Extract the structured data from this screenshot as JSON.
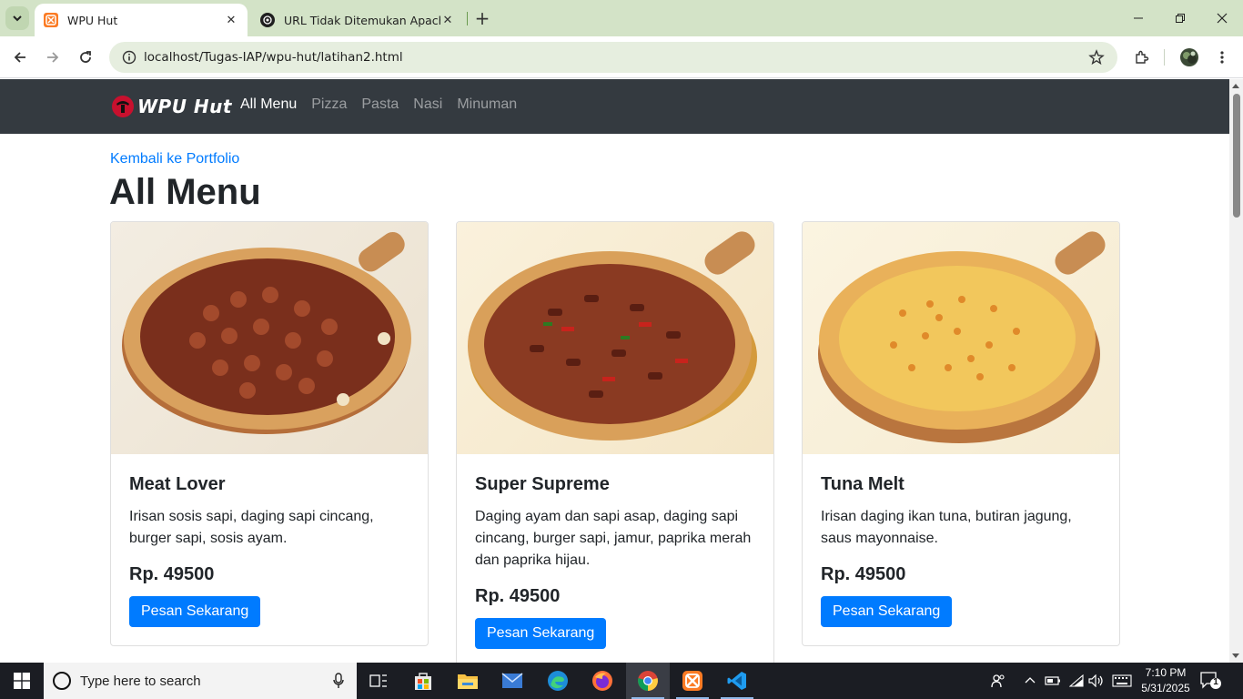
{
  "browser": {
    "tabs": [
      {
        "title": "WPU Hut",
        "active": true
      },
      {
        "title": "URL Tidak Ditemukan Apache",
        "active": false
      }
    ],
    "url": "localhost/Tugas-IAP/wpu-hut/latihan2.html"
  },
  "navbar": {
    "brand": "WPU Hut",
    "items": [
      {
        "label": "All Menu",
        "active": true
      },
      {
        "label": "Pizza",
        "active": false
      },
      {
        "label": "Pasta",
        "active": false
      },
      {
        "label": "Nasi",
        "active": false
      },
      {
        "label": "Minuman",
        "active": false
      }
    ]
  },
  "page": {
    "back_link": "Kembali ke Portfolio",
    "title": "All Menu",
    "cards": [
      {
        "name": "Meat Lover",
        "description": "Irisan sosis sapi, daging sapi cincang, burger sapi, sosis ayam.",
        "price": "Rp. 49500",
        "button": "Pesan Sekarang"
      },
      {
        "name": "Super Supreme",
        "description": "Daging ayam dan sapi asap, daging sapi cincang, burger sapi, jamur, paprika merah dan paprika hijau.",
        "price": "Rp. 49500",
        "button": "Pesan Sekarang"
      },
      {
        "name": "Tuna Melt",
        "description": "Irisan daging ikan tuna, butiran jagung, saus mayonnaise.",
        "price": "Rp. 49500",
        "button": "Pesan Sekarang"
      }
    ]
  },
  "taskbar": {
    "search_placeholder": "Type here to search",
    "time": "7:10 PM",
    "date": "5/31/2025",
    "notification_count": "1"
  },
  "colors": {
    "tabbar": "#d3e3c7",
    "navbar": "#343a40",
    "primary": "#007bff"
  }
}
